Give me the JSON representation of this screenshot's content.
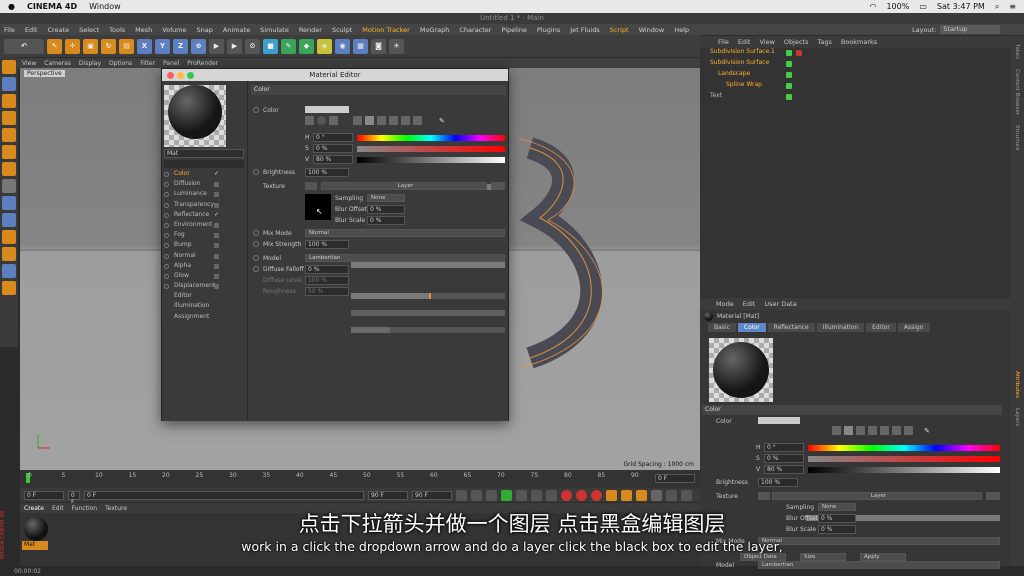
{
  "mac": {
    "app": "CINEMA 4D",
    "menu_window": "Window",
    "battery": "100%",
    "clock": "Sat 3:47 PM"
  },
  "c4d": {
    "doc_title": "Untitled 1 * - Main",
    "menu": [
      "File",
      "Edit",
      "Create",
      "Select",
      "Tools",
      "Mesh",
      "Volume",
      "Snap",
      "Animate",
      "Simulate",
      "Render",
      "Sculpt",
      "Motion Tracker",
      "MoGraph",
      "Character",
      "Pipeline",
      "Plugins",
      "Jet Fluids",
      "Script",
      "Window",
      "Help"
    ],
    "layout_label": "Layout:",
    "layout_value": "Startup"
  },
  "viewport": {
    "menu": [
      "View",
      "Cameras",
      "Display",
      "Options",
      "Filter",
      "Panel",
      "ProRender"
    ],
    "label": "Perspective",
    "grid_spacing": "Grid Spacing : 1000 cm"
  },
  "timeline": {
    "ticks": [
      "0",
      "5",
      "10",
      "15",
      "20",
      "25",
      "30",
      "35",
      "40",
      "45",
      "50",
      "55",
      "60",
      "65",
      "70",
      "75",
      "80",
      "85",
      "90"
    ],
    "current_frame": "0 F",
    "start": "0 F",
    "range_start": "0 F",
    "range_end": "90 F",
    "end": "90 F",
    "right_field": "0 F"
  },
  "material_manager": {
    "menu": [
      "Create",
      "Edit",
      "Function",
      "Texture"
    ],
    "material_name": "Mat"
  },
  "status_bar": {
    "time": "00:00:02"
  },
  "object_manager": {
    "menu": [
      "File",
      "Edit",
      "View",
      "Objects",
      "Tags",
      "Bookmarks"
    ],
    "objects": [
      {
        "name": "Subdivision Surface.1"
      },
      {
        "name": "Subdivision Surface"
      },
      {
        "name": "Landscape"
      },
      {
        "name": "Spline Wrap"
      },
      {
        "name": "Text"
      }
    ]
  },
  "side_tabs": [
    "Takes",
    "Content Browser",
    "Structure"
  ],
  "side_tabs_lower": [
    "Attributes",
    "Layers"
  ],
  "attributes": {
    "menu": [
      "Mode",
      "Edit",
      "User Data"
    ],
    "object_label": "Material [Mat]",
    "tabs": [
      "Basic",
      "Color",
      "Reflectance",
      "Illumination",
      "Editor",
      "Assign"
    ],
    "section": "Color",
    "color_label": "Color",
    "h": "0 °",
    "s": "0 %",
    "v": "80 %",
    "brightness_label": "Brightness",
    "brightness": "100 %",
    "texture_label": "Texture",
    "layer_btn": "Layer",
    "sampling_label": "Sampling",
    "sampling": "None",
    "blur_offset_label": "Blur Offset",
    "blur_offset": "0 %",
    "blur_scale_label": "Blur Scale",
    "blur_scale": "0 %",
    "mix_mode_label": "Mix Mode",
    "mix_mode": "Normal",
    "object_btn": "Object Data",
    "size_btn": "Size",
    "apply_btn": "Apply",
    "model_label": "Model",
    "model": "Lambertian"
  },
  "material_editor": {
    "title": "Material Editor",
    "name": "Mat",
    "channels": [
      {
        "label": "Color",
        "on": true
      },
      {
        "label": "Diffusion",
        "on": false
      },
      {
        "label": "Luminance",
        "on": false
      },
      {
        "label": "Transparency",
        "on": false
      },
      {
        "label": "Reflectance",
        "on": true
      },
      {
        "label": "Environment",
        "on": false
      },
      {
        "label": "Fog",
        "on": false
      },
      {
        "label": "Bump",
        "on": false
      },
      {
        "label": "Normal",
        "on": false
      },
      {
        "label": "Alpha",
        "on": false
      },
      {
        "label": "Glow",
        "on": false
      },
      {
        "label": "Displacement",
        "on": false
      },
      {
        "label": "Editor",
        "on": false
      },
      {
        "label": "Illumination",
        "on": false
      },
      {
        "label": "Assignment",
        "on": false
      }
    ],
    "section": "Color",
    "color_label": "Color",
    "h": "0 °",
    "s": "0 %",
    "v": "80 %",
    "brightness_label": "Brightness",
    "brightness": "100 %",
    "texture_label": "Texture",
    "layer_btn": "Layer",
    "sampling_label": "Sampling",
    "sampling": "None",
    "blur_offset_label": "Blur Offset",
    "blur_offset": "0 %",
    "blur_scale_label": "Blur Scale",
    "blur_scale": "0 %",
    "mix_mode_label": "Mix Mode",
    "mix_mode": "Normal",
    "mix_strength_label": "Mix Strength",
    "mix_strength": "100 %",
    "model_label": "Model",
    "model": "Lambertian",
    "diffuse_falloff_label": "Diffuse Falloff",
    "diffuse_falloff": "0 %",
    "diffuse_level_label": "Diffuse Level",
    "diffuse_level": "100 %",
    "roughness_label": "Roughness",
    "roughness": "50 %"
  },
  "subtitles": {
    "zh": "点击下拉箭头并做一个图层 点击黑盒编辑图层",
    "en": "work in a click the dropdown arrow and do a layer click the black box to edit the layer,"
  },
  "colors": {
    "accent": "#ffb030",
    "active_tab": "#5d87c8",
    "ui_bg": "#333333"
  }
}
